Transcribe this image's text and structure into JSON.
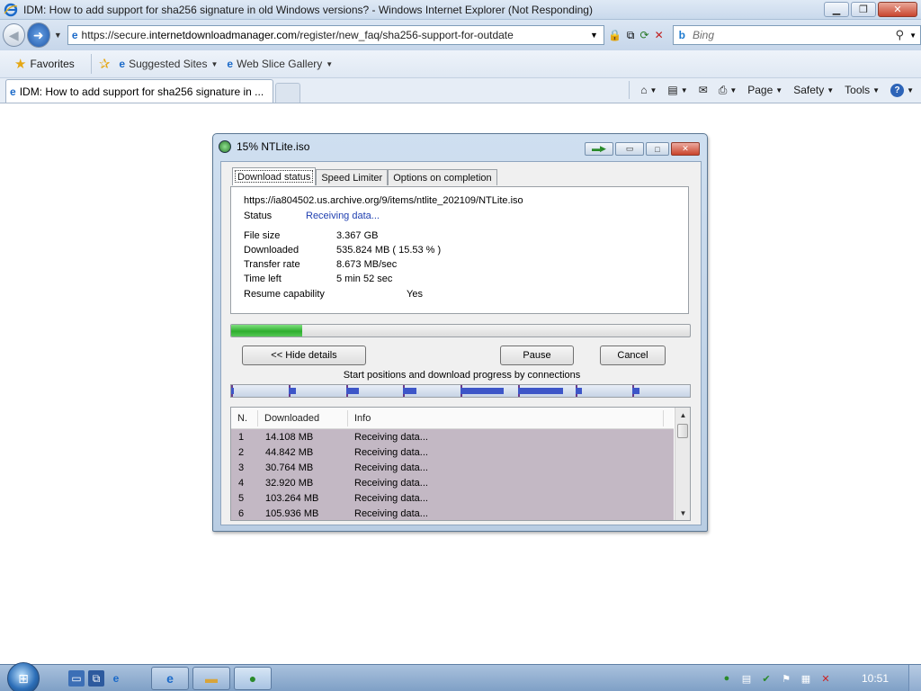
{
  "browser": {
    "window_title": "IDM: How to add support for sha256 signature in old Windows versions? - Windows Internet Explorer (Not Responding)",
    "url_prefix": "https://secure.",
    "url_domain": "internetdownloadmanager.com",
    "url_rest": "/register/new_faq/sha256-support-for-outdate",
    "search_placeholder": "Bing",
    "favorites_label": "Favorites",
    "suggested_sites_label": "Suggested Sites",
    "web_slice_label": "Web Slice Gallery",
    "tab_title": "IDM: How to add support for sha256 signature in ...",
    "commands": {
      "page": "Page",
      "safety": "Safety",
      "tools": "Tools"
    }
  },
  "dialog": {
    "title": "15% NTLite.iso",
    "tabs": [
      "Download status",
      "Speed Limiter",
      "Options on completion"
    ],
    "url": "https://ia804502.us.archive.org/9/items/ntlite_202109/NTLite.iso",
    "status_label": "Status",
    "status_value": "Receiving data...",
    "fields": [
      {
        "label": "File size",
        "value": "3.367  GB"
      },
      {
        "label": "Downloaded",
        "value": "535.824  MB  ( 15.53 % )"
      },
      {
        "label": "Transfer rate",
        "value": "8.673  MB/sec"
      },
      {
        "label": "Time left",
        "value": "5 min 52 sec"
      }
    ],
    "resume_label": "Resume capability",
    "resume_value": "Yes",
    "progress": 0.1553,
    "buttons": {
      "details": "<< Hide details",
      "pause": "Pause",
      "cancel": "Cancel"
    },
    "connections_caption": "Start positions and download progress by connections",
    "connection_progress": [
      0.042,
      0.133,
      0.229,
      0.239,
      0.752,
      0.786,
      0.124,
      0.124
    ],
    "table_headers": {
      "n": "N.",
      "downloaded": "Downloaded",
      "info": "Info"
    },
    "connections": [
      {
        "n": "1",
        "downloaded": "14.108  MB",
        "info": "Receiving data..."
      },
      {
        "n": "2",
        "downloaded": "44.842  MB",
        "info": "Receiving data..."
      },
      {
        "n": "3",
        "downloaded": "30.764  MB",
        "info": "Receiving data..."
      },
      {
        "n": "4",
        "downloaded": "32.920  MB",
        "info": "Receiving data..."
      },
      {
        "n": "5",
        "downloaded": "103.264  MB",
        "info": "Receiving data..."
      },
      {
        "n": "6",
        "downloaded": "105.936  MB",
        "info": "Receiving data..."
      }
    ]
  },
  "taskbar": {
    "clock": "10:51"
  },
  "colors": {
    "progress_green": "#2fae2f",
    "connection_blue": "#3d56c8",
    "rows_bg": "#c3b8c4"
  }
}
